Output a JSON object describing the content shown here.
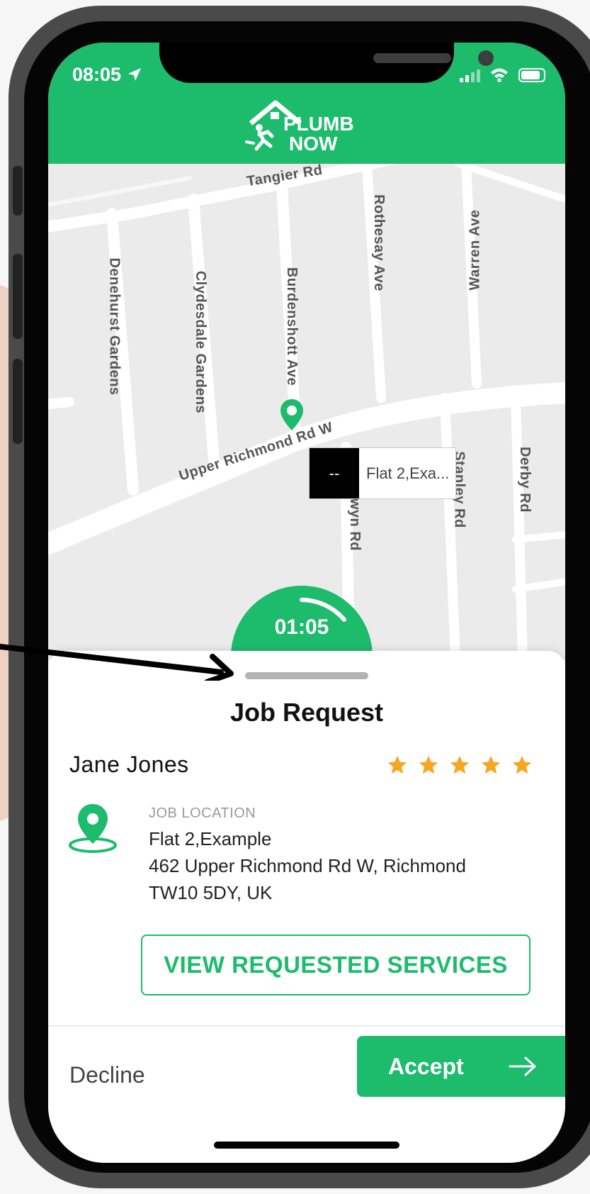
{
  "status_bar": {
    "time": "08:05"
  },
  "header": {
    "logo_line1": "PLUMB",
    "logo_line2": "NOW"
  },
  "map": {
    "streets": [
      "Tangier Rd",
      "Rothesay Ave",
      "Warren Ave",
      "Denehurst Gardens",
      "Clydesdale Gardens",
      "Burdenshott Ave",
      "Upper Richmond Rd W",
      "Berwyn Rd",
      "Stanley Rd",
      "Derby Rd"
    ],
    "marker": {
      "code": "--",
      "label": "Flat 2,Exa..."
    },
    "timer": "01:05"
  },
  "job_sheet": {
    "title": "Job Request",
    "customer_name": "Jane  Jones",
    "rating": 5,
    "location_label": "JOB LOCATION",
    "address": [
      "Flat 2,Example",
      "462 Upper Richmond Rd W,  Richmond",
      "TW10 5DY,  UK"
    ],
    "view_services_label": "VIEW REQUESTED SERVICES",
    "decline_label": "Decline",
    "accept_label": "Accept"
  },
  "colors": {
    "brand_green": "#1dbb6c",
    "star": "#f5a623"
  }
}
